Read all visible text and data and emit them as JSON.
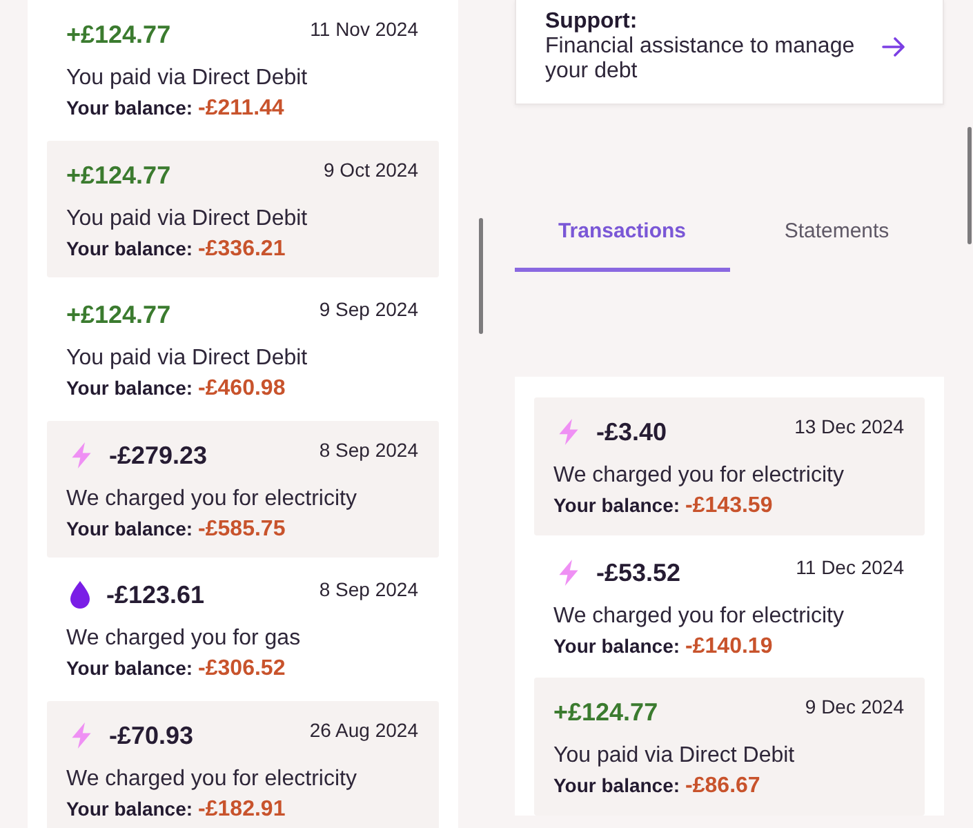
{
  "screens": [
    {
      "transactions": [
        {
          "kind": "payment",
          "shaded": false,
          "amount": "+£124.77",
          "date": "11 Nov 2024",
          "description": "You paid via Direct Debit",
          "balance_label": "Your balance:",
          "balance": "-£211.44"
        },
        {
          "kind": "payment",
          "shaded": true,
          "amount": "+£124.77",
          "date": "9 Oct 2024",
          "description": "You paid via Direct Debit",
          "balance_label": "Your balance:",
          "balance": "-£336.21"
        },
        {
          "kind": "payment",
          "shaded": false,
          "amount": "+£124.77",
          "date": "9 Sep 2024",
          "description": "You paid via Direct Debit",
          "balance_label": "Your balance:",
          "balance": "-£460.98"
        },
        {
          "kind": "electricity",
          "shaded": true,
          "amount": "-£279.23",
          "date": "8 Sep 2024",
          "description": "We charged you for electricity",
          "balance_label": "Your balance:",
          "balance": "-£585.75"
        },
        {
          "kind": "gas",
          "shaded": false,
          "amount": "-£123.61",
          "date": "8 Sep 2024",
          "description": "We charged you for gas",
          "balance_label": "Your balance:",
          "balance": "-£306.52"
        },
        {
          "kind": "electricity",
          "shaded": true,
          "amount": "-£70.93",
          "date": "26 Aug 2024",
          "description": "We charged you for electricity",
          "balance_label": "Your balance:",
          "balance": "-£182.91"
        }
      ]
    },
    {
      "support": {
        "title": "Support:",
        "text": "Financial assistance to manage your debt"
      },
      "tabs": [
        {
          "label": "Transactions",
          "selected": true
        },
        {
          "label": "Statements",
          "selected": false
        }
      ],
      "transactions": [
        {
          "kind": "electricity",
          "shaded": true,
          "amount": "-£3.40",
          "date": "13 Dec 2024",
          "description": "We charged you for electricity",
          "balance_label": "Your balance:",
          "balance": "-£143.59"
        },
        {
          "kind": "electricity",
          "shaded": false,
          "amount": "-£53.52",
          "date": "11 Dec 2024",
          "description": "We charged you for electricity",
          "balance_label": "Your balance:",
          "balance": "-£140.19"
        },
        {
          "kind": "payment",
          "shaded": true,
          "amount": "+£124.77",
          "date": "9 Dec 2024",
          "description": "You paid via Direct Debit",
          "balance_label": "Your balance:",
          "balance": "-£86.67"
        }
      ]
    }
  ]
}
